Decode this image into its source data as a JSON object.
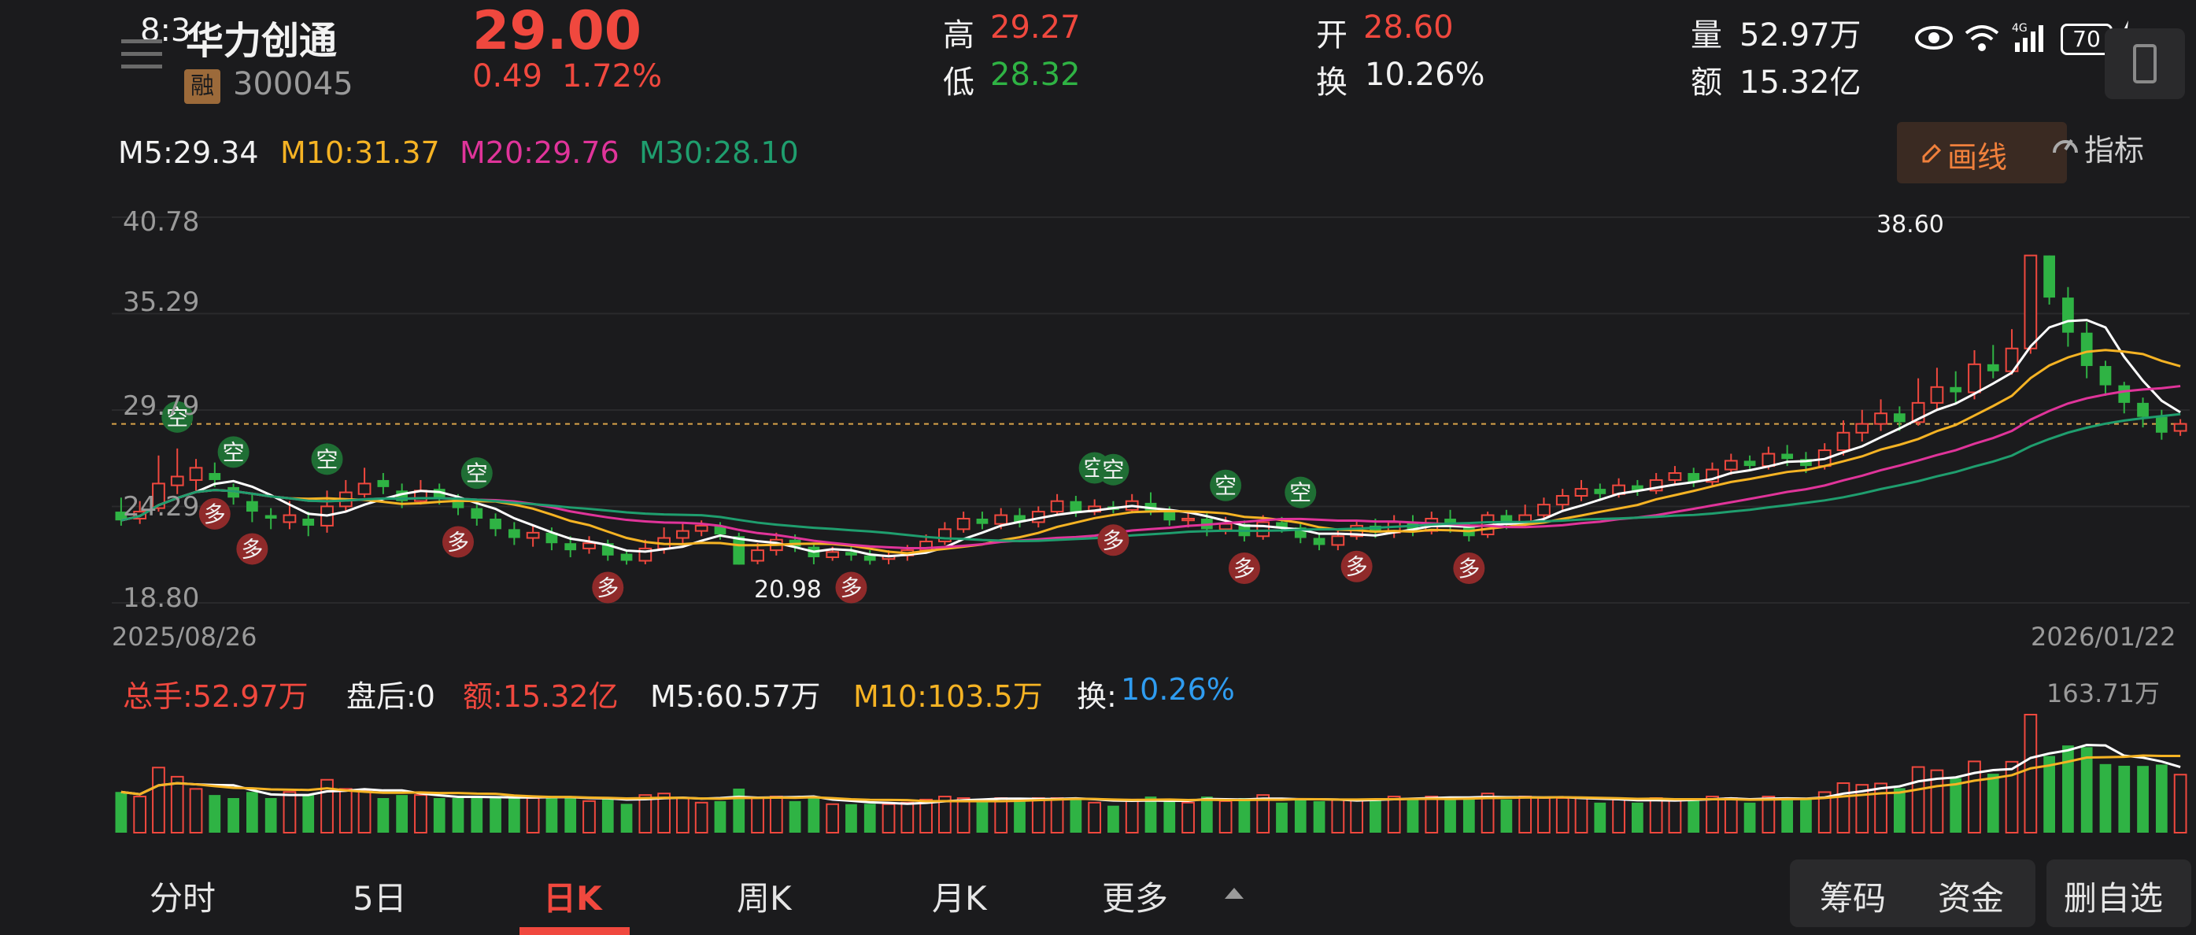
{
  "status_bar": {
    "time": "8:3",
    "battery": "70"
  },
  "stock": {
    "name": "华力创通",
    "badge": "融",
    "code": "300045",
    "price": "29.00",
    "change": "0.49",
    "change_pct": "1.72%"
  },
  "quote": {
    "high_label": "高",
    "high": "29.27",
    "low_label": "低",
    "low": "28.32",
    "open_label": "开",
    "open": "28.60",
    "turnover_label": "换",
    "turnover": "10.26%",
    "volume_label": "量",
    "volume": "52.97万",
    "amount_label": "额",
    "amount": "15.32亿"
  },
  "ma_line": {
    "m5": "M5:29.34",
    "m10": "M10:31.37",
    "m20": "M20:29.76",
    "m30": "M30:28.10"
  },
  "toolbar": {
    "draw_label": "画线",
    "indicator_label": "指标"
  },
  "axis": {
    "y_labels": [
      "40.78",
      "35.29",
      "29.79",
      "24.29",
      "18.80"
    ],
    "date_start": "2025/08/26",
    "date_end": "2026/01/22",
    "max_marker": "38.60",
    "min_marker": "20.98"
  },
  "volume_panel": {
    "total": "总手:52.97万",
    "after_hours": "盘后:0",
    "amount": "额:15.32亿",
    "m5": "M5:60.57万",
    "m10": "M10:103.5万",
    "turnover_label": "换:",
    "turnover": "10.26%",
    "max_label": "163.71万"
  },
  "signals": {
    "long": "多",
    "short": "空"
  },
  "tabs": [
    "分时",
    "5日",
    "日K",
    "周K",
    "月K",
    "更多"
  ],
  "active_tab": "日K",
  "right_buttons": {
    "chips": "筹码",
    "funds": "资金",
    "remove_watch": "删自选"
  },
  "colors": {
    "up": "#f0483e",
    "down": "#2fb344",
    "ma5": "#ffffff",
    "ma10": "#f5b324",
    "ma20": "#e0349a",
    "ma30": "#1f9e6e",
    "background": "#1b1b1d"
  },
  "chart_data": {
    "type": "candlestick",
    "y_range": [
      18.8,
      40.78
    ],
    "candles": [
      [
        24.0,
        23.5,
        24.8,
        23.2
      ],
      [
        23.6,
        24.0,
        24.6,
        23.3
      ],
      [
        24.2,
        25.6,
        27.2,
        24.0
      ],
      [
        25.5,
        26.0,
        27.6,
        25.0
      ],
      [
        25.8,
        26.5,
        27.0,
        25.2
      ],
      [
        26.2,
        25.8,
        26.8,
        25.4
      ],
      [
        25.4,
        24.8,
        25.6,
        24.4
      ],
      [
        24.6,
        24.0,
        25.0,
        23.4
      ],
      [
        23.8,
        23.6,
        24.2,
        23.0
      ],
      [
        23.4,
        23.8,
        24.6,
        23.0
      ],
      [
        23.6,
        23.2,
        24.0,
        22.6
      ],
      [
        23.2,
        24.3,
        25.2,
        22.8
      ],
      [
        24.3,
        25.1,
        25.8,
        24.0
      ],
      [
        25.0,
        25.6,
        26.5,
        24.8
      ],
      [
        25.8,
        25.4,
        26.2,
        25.0
      ],
      [
        25.2,
        24.6,
        25.6,
        24.2
      ],
      [
        24.6,
        25.2,
        25.8,
        24.4
      ],
      [
        25.3,
        24.8,
        25.6,
        24.4
      ],
      [
        24.7,
        24.2,
        25.0,
        23.8
      ],
      [
        24.2,
        23.6,
        24.4,
        23.2
      ],
      [
        23.6,
        23.0,
        23.9,
        22.6
      ],
      [
        23.0,
        22.5,
        23.4,
        22.1
      ],
      [
        22.5,
        22.8,
        23.2,
        22.0
      ],
      [
        22.8,
        22.2,
        23.1,
        21.8
      ],
      [
        22.2,
        21.8,
        22.6,
        21.4
      ],
      [
        21.9,
        22.2,
        22.6,
        21.6
      ],
      [
        22.2,
        21.5,
        22.4,
        21.2
      ],
      [
        21.6,
        21.2,
        21.8,
        20.98
      ],
      [
        21.2,
        21.9,
        22.4,
        21.0
      ],
      [
        21.9,
        22.5,
        23.1,
        21.6
      ],
      [
        22.5,
        22.9,
        23.4,
        22.2
      ],
      [
        22.9,
        23.2,
        23.5,
        22.6
      ],
      [
        23.2,
        22.7,
        23.4,
        22.4
      ],
      [
        22.6,
        20.98,
        22.8,
        20.98
      ],
      [
        21.2,
        21.8,
        22.2,
        21.0
      ],
      [
        21.8,
        22.4,
        22.8,
        21.5
      ],
      [
        22.4,
        22.0,
        22.7,
        21.7
      ],
      [
        22.0,
        21.4,
        22.2,
        21.0
      ],
      [
        21.4,
        21.7,
        22.0,
        21.2
      ],
      [
        21.7,
        21.5,
        22.0,
        21.2
      ],
      [
        21.5,
        21.2,
        21.8,
        20.98
      ],
      [
        21.3,
        21.5,
        21.8,
        21.0
      ],
      [
        21.5,
        21.8,
        22.1,
        21.2
      ],
      [
        21.8,
        22.3,
        22.7,
        21.6
      ],
      [
        22.3,
        23.0,
        23.4,
        22.1
      ],
      [
        23.0,
        23.6,
        24.0,
        22.8
      ],
      [
        23.6,
        23.3,
        24.0,
        23.0
      ],
      [
        23.3,
        23.8,
        24.2,
        23.0
      ],
      [
        23.8,
        23.4,
        24.2,
        23.1
      ],
      [
        23.4,
        24.0,
        24.3,
        23.1
      ],
      [
        24.0,
        24.6,
        25.0,
        23.8
      ],
      [
        24.6,
        24.0,
        24.9,
        23.7
      ],
      [
        24.0,
        24.3,
        24.7,
        23.8
      ],
      [
        24.3,
        24.1,
        24.6,
        23.9
      ],
      [
        24.1,
        24.6,
        25.0,
        23.9
      ],
      [
        24.5,
        24.0,
        25.1,
        23.8
      ],
      [
        24.0,
        23.5,
        24.3,
        23.2
      ],
      [
        23.5,
        23.6,
        24.0,
        23.1
      ],
      [
        23.6,
        23.0,
        23.9,
        22.6
      ],
      [
        23.0,
        23.3,
        23.7,
        22.7
      ],
      [
        23.3,
        22.6,
        23.5,
        22.3
      ],
      [
        22.6,
        23.4,
        23.8,
        22.4
      ],
      [
        23.4,
        23.1,
        23.7,
        22.8
      ],
      [
        23.1,
        22.5,
        23.3,
        22.2
      ],
      [
        22.5,
        22.1,
        22.8,
        21.8
      ],
      [
        22.1,
        22.6,
        22.9,
        21.8
      ],
      [
        22.6,
        23.2,
        23.5,
        22.4
      ],
      [
        23.2,
        22.8,
        23.6,
        22.5
      ],
      [
        22.8,
        23.4,
        23.8,
        22.5
      ],
      [
        23.4,
        22.9,
        23.8,
        22.6
      ],
      [
        22.9,
        23.6,
        24.0,
        22.7
      ],
      [
        23.6,
        23.2,
        24.1,
        22.8
      ],
      [
        23.2,
        22.6,
        23.4,
        22.3
      ],
      [
        22.7,
        23.8,
        24.0,
        22.5
      ],
      [
        23.8,
        23.3,
        24.1,
        23.0
      ],
      [
        23.3,
        23.8,
        24.4,
        23.1
      ],
      [
        23.8,
        24.4,
        24.8,
        23.6
      ],
      [
        24.4,
        24.9,
        25.3,
        24.1
      ],
      [
        24.9,
        25.3,
        25.8,
        24.6
      ],
      [
        25.3,
        25.0,
        25.6,
        24.7
      ],
      [
        25.0,
        25.5,
        25.9,
        24.8
      ],
      [
        25.5,
        25.2,
        25.8,
        24.9
      ],
      [
        25.2,
        25.8,
        26.2,
        25.0
      ],
      [
        25.8,
        26.2,
        26.6,
        25.5
      ],
      [
        26.2,
        25.7,
        26.5,
        25.4
      ],
      [
        25.7,
        26.4,
        26.8,
        25.5
      ],
      [
        26.4,
        26.9,
        27.3,
        26.1
      ],
      [
        26.9,
        26.6,
        27.2,
        26.3
      ],
      [
        26.6,
        27.3,
        27.7,
        26.4
      ],
      [
        27.3,
        27.0,
        27.8,
        26.6
      ],
      [
        27.0,
        26.6,
        27.4,
        26.2
      ],
      [
        26.6,
        27.5,
        27.9,
        26.4
      ],
      [
        27.5,
        28.5,
        29.2,
        27.2
      ],
      [
        28.5,
        29.0,
        29.8,
        28.0
      ],
      [
        29.0,
        29.6,
        30.4,
        28.6
      ],
      [
        29.6,
        29.1,
        30.0,
        28.6
      ],
      [
        29.1,
        30.2,
        31.6,
        28.9
      ],
      [
        30.2,
        31.1,
        32.2,
        29.8
      ],
      [
        31.1,
        30.8,
        32.0,
        30.2
      ],
      [
        30.8,
        32.4,
        33.2,
        30.4
      ],
      [
        32.4,
        32.0,
        33.5,
        31.6
      ],
      [
        32.0,
        33.3,
        34.4,
        31.8
      ],
      [
        33.3,
        38.6,
        38.6,
        33.0
      ],
      [
        38.6,
        36.2,
        38.6,
        35.8
      ],
      [
        36.2,
        34.2,
        36.8,
        33.4
      ],
      [
        34.2,
        32.3,
        34.8,
        31.6
      ],
      [
        32.3,
        31.2,
        32.6,
        30.6
      ],
      [
        31.2,
        30.2,
        31.4,
        29.6
      ],
      [
        30.2,
        29.4,
        30.5,
        28.8
      ],
      [
        29.4,
        28.5,
        29.8,
        28.1
      ],
      [
        28.6,
        29.0,
        29.27,
        28.32
      ]
    ],
    "volume_max": "163.71万"
  }
}
